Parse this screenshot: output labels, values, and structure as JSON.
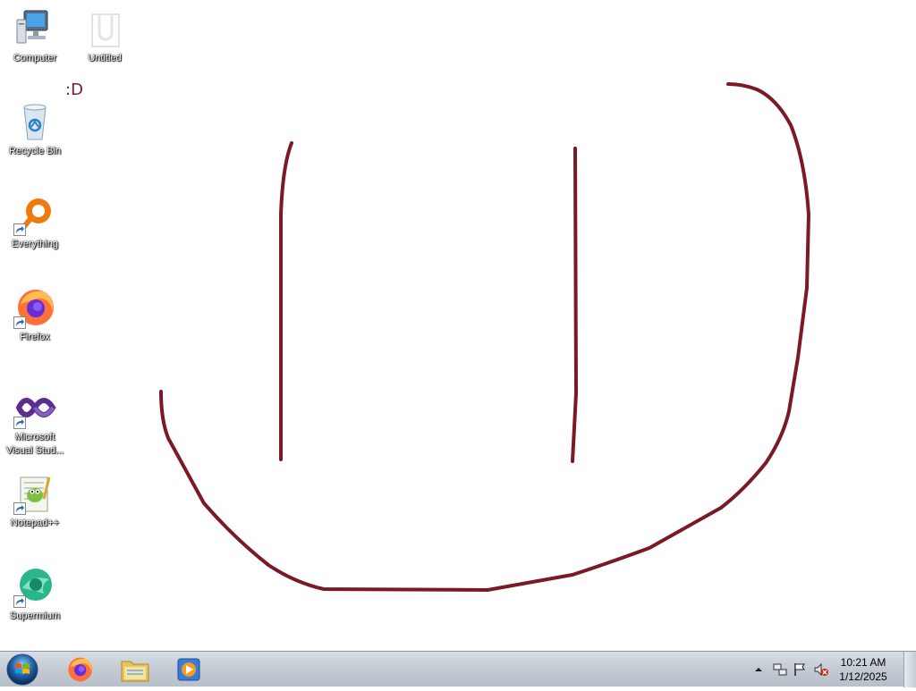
{
  "desktop": {
    "icons": [
      {
        "label": "Computer",
        "icon": "computer-icon"
      },
      {
        "label": "Untitled",
        "icon": "document-icon"
      },
      {
        "label": "Recycle Bin",
        "icon": "recycle-bin-icon"
      },
      {
        "label": "Everything",
        "icon": "everything-search-icon"
      },
      {
        "label": "Firefox",
        "icon": "firefox-icon"
      },
      {
        "label": "Microsoft Visual Stud...",
        "icon": "visual-studio-icon"
      },
      {
        "label": "Notepad++",
        "icon": "notepadpp-icon"
      },
      {
        "label": "Supermium",
        "icon": "supermium-icon"
      }
    ],
    "smiley_text": ":D",
    "ink_color": "#7a1a26"
  },
  "taskbar": {
    "pinned": [
      {
        "name": "firefox-taskbar-button",
        "icon": "firefox-icon"
      },
      {
        "name": "explorer-taskbar-button",
        "icon": "folder-icon"
      },
      {
        "name": "media-player-taskbar-button",
        "icon": "media-player-icon"
      }
    ],
    "tray": {
      "icons": [
        "chevron-up-icon",
        "network-icon",
        "action-center-flag-icon",
        "volume-muted-icon"
      ],
      "time": "10:21 AM",
      "date": "1/12/2025"
    }
  }
}
